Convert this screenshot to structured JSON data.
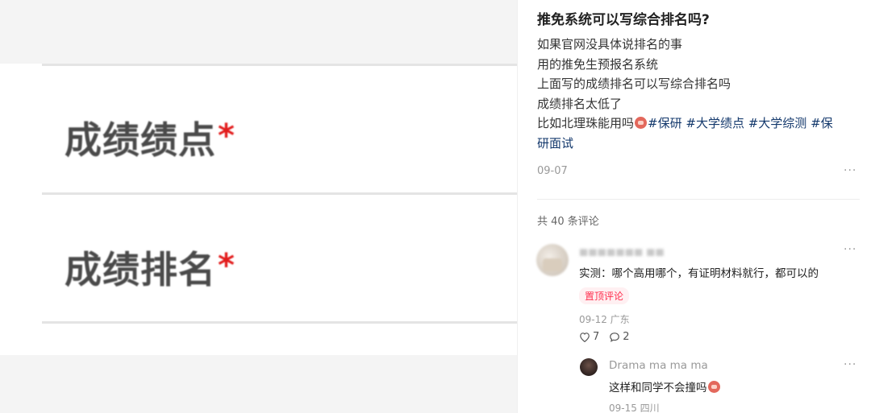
{
  "left_image": {
    "labels": [
      {
        "text": "成绩绩点",
        "required_mark": "*"
      },
      {
        "text": "成绩排名",
        "required_mark": "*"
      }
    ]
  },
  "post": {
    "title": "推免系统可以写综合排名吗?",
    "body_lines": [
      "如果官网没具体说排名的事",
      "用的推免生预报名系统",
      "上面写的成绩排名可以写综合排名吗",
      "成绩排名太低了"
    ],
    "last_line_text": "比如北理珠能用吗",
    "tags_line1": [
      "#保研",
      "#大学绩点",
      "#大学综测",
      "#保"
    ],
    "tags_line2": "研面试",
    "date": "09-07",
    "more_icon": "more-icon"
  },
  "comments": {
    "count_label": "共 40 条评论",
    "items": [
      {
        "username": "■■■■■■■ ■■",
        "text": "实测：哪个高用哪个，有证明材料就行，都可以的",
        "badge": "置顶评论",
        "meta": "09-12 广东",
        "likes": "7",
        "replies": "2"
      },
      {
        "username": "Drama ma ma ma",
        "text": "这样和同学不会撞吗",
        "meta": "09-15 四川"
      }
    ]
  },
  "colors": {
    "tag": "#13386c",
    "badge": "#ff2e4d",
    "required": "#e21b1b"
  }
}
